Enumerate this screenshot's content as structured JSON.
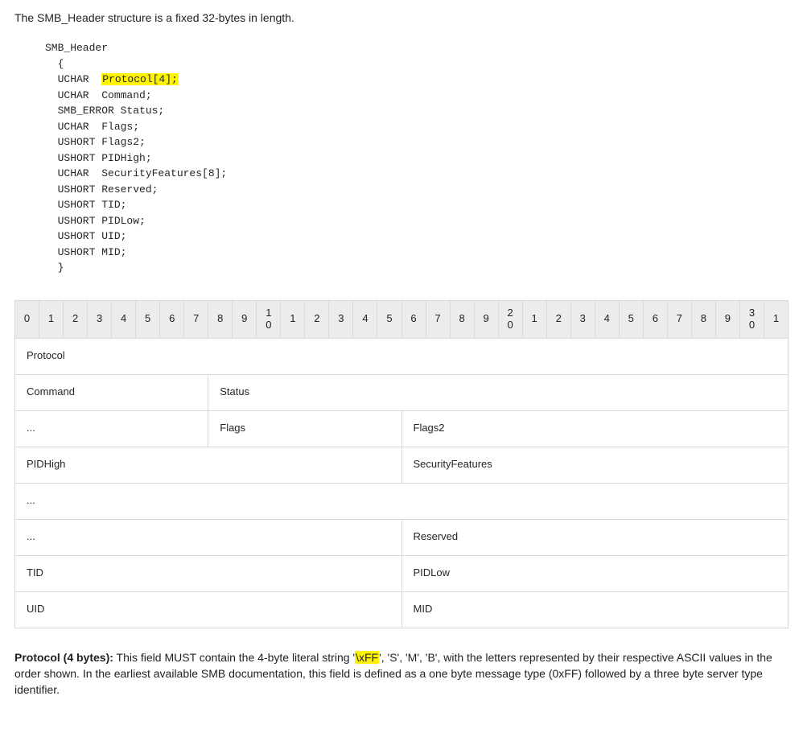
{
  "intro": "The SMB_Header structure is a fixed 32-bytes in length.",
  "code": {
    "l0": "SMB_Header",
    "l1": "  {",
    "l2a": "  UCHAR  ",
    "l2b": "Protocol[4];",
    "l3": "  UCHAR  Command;",
    "l4": "  SMB_ERROR Status;",
    "l5": "  UCHAR  Flags;",
    "l6": "  USHORT Flags2;",
    "l7": "  USHORT PIDHigh;",
    "l8": "  UCHAR  SecurityFeatures[8];",
    "l9": "  USHORT Reserved;",
    "l10": "  USHORT TID;",
    "l11": "  USHORT PIDLow;",
    "l12": "  USHORT UID;",
    "l13": "  USHORT MID;",
    "l14": "  }"
  },
  "bits": [
    "0",
    "1",
    "2",
    "3",
    "4",
    "5",
    "6",
    "7",
    "8",
    "9",
    "1\n0",
    "1",
    "2",
    "3",
    "4",
    "5",
    "6",
    "7",
    "8",
    "9",
    "2\n0",
    "1",
    "2",
    "3",
    "4",
    "5",
    "6",
    "7",
    "8",
    "9",
    "3\n0",
    "1"
  ],
  "rows": {
    "protocol": "Protocol",
    "command": "Command",
    "status": "Status",
    "ellipsis": "...",
    "flags": "Flags",
    "flags2": "Flags2",
    "pidhigh": "PIDHigh",
    "secfeat": "SecurityFeatures",
    "reserved": "Reserved",
    "tid": "TID",
    "pidlow": "PIDLow",
    "uid": "UID",
    "mid": "MID"
  },
  "footer": {
    "lead": "Protocol (4 bytes):",
    "p1": " This field MUST contain the 4-byte literal string '",
    "hl": "\\xFF",
    "p2": "', 'S', 'M', 'B', with the letters represented by their respective ASCII values in the order shown. In the earliest available SMB documentation, this field is defined as a one byte message type (0xFF) followed by a three byte server type identifier."
  }
}
